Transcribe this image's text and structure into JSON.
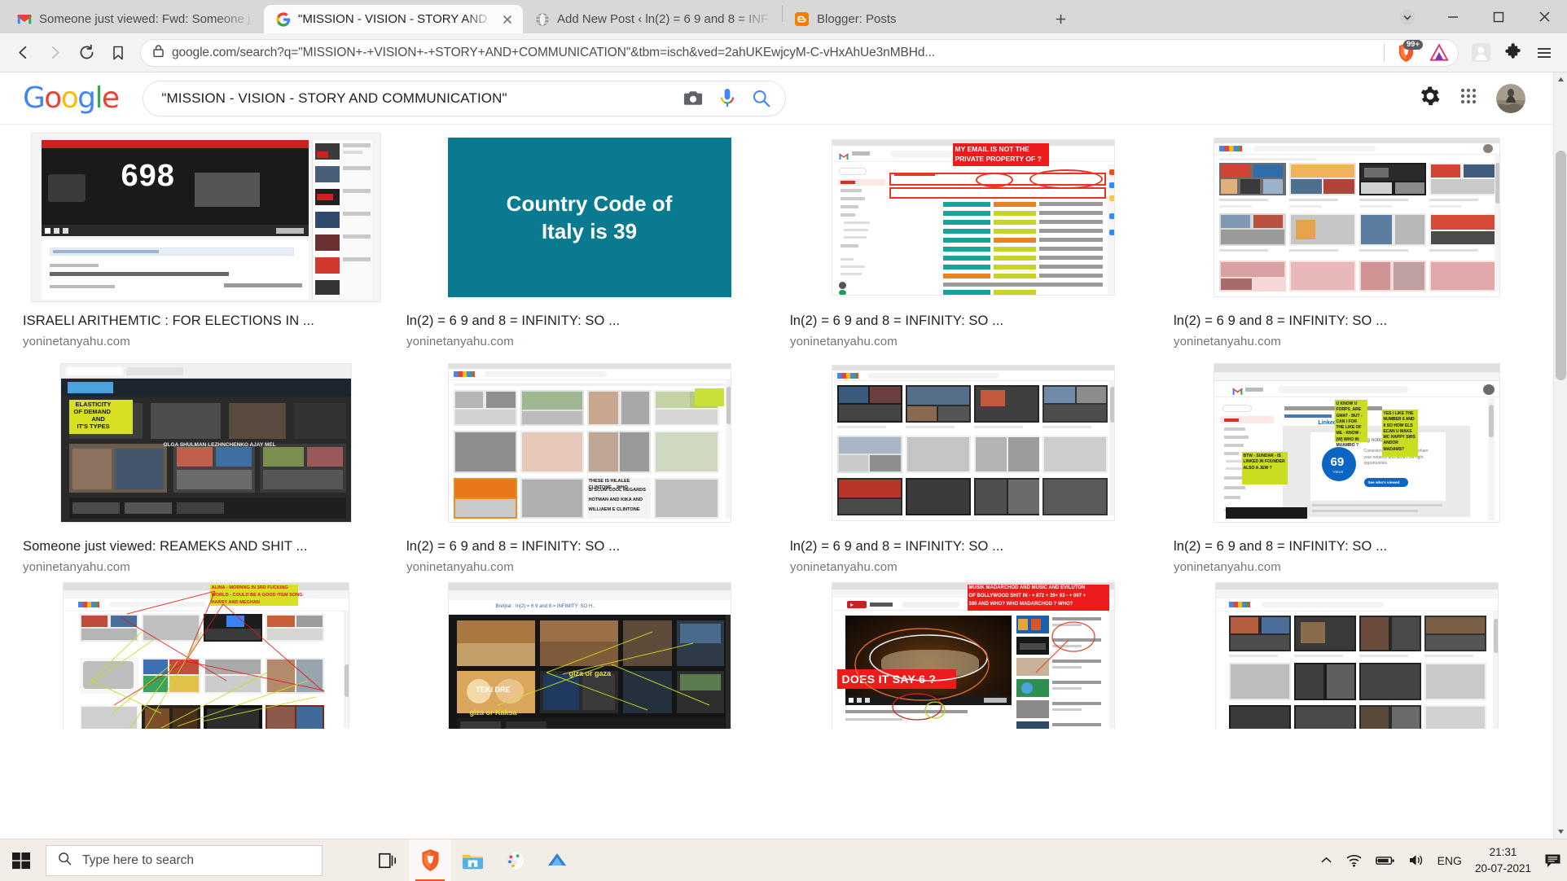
{
  "window": {
    "tabs": [
      {
        "title": "Someone just viewed: Fwd: Someone j",
        "favicon": "gmail-icon",
        "active": false
      },
      {
        "title": "\"MISSION - VISION - STORY AND",
        "favicon": "google-icon",
        "active": true
      },
      {
        "title": "Add New Post ‹ ln(2) = 6 9 and 8 = INF",
        "favicon": "globe-icon",
        "active": false
      },
      {
        "title": "Blogger: Posts",
        "favicon": "blogger-icon",
        "active": false
      }
    ],
    "new_tab_label": "+",
    "controls": {
      "minimize": "–",
      "maximize": "☐",
      "close": "✕",
      "tab_list": "▾"
    }
  },
  "toolbar": {
    "back": "back-arrow",
    "forward": "forward-arrow",
    "reload": "reload-arrow",
    "bookmark": "bookmark-outline",
    "url": "google.com/search?q=\"MISSION+-+VISION+-+STORY+AND+COMMUNICATION\"&tbm=isch&ved=2ahUKEwjcyM-C-vHxAhUe3nMBHd...",
    "shields_badge": "99+",
    "icons": [
      "brave-shields-icon",
      "brave-rewards-icon",
      "profile-icon",
      "extensions-icon",
      "menu-icon"
    ]
  },
  "google": {
    "logo": "Google",
    "query": "\"MISSION - VISION - STORY AND COMMUNICATION\"",
    "search_icons": [
      "camera-icon",
      "microphone-icon",
      "search-icon"
    ],
    "header_icons": [
      "settings-gear-icon",
      "google-apps-icon",
      "account-avatar"
    ]
  },
  "results": [
    [
      {
        "title": "ISRAELI ARITHEMTIC : FOR ELECTIONS IN ...",
        "site": "yoninetanyahu.com",
        "kind": "youtube-dark",
        "big_number": "698"
      },
      {
        "title": "ln(2) = 6 9 and 8 = INFINITY: SO ...",
        "site": "yoninetanyahu.com",
        "kind": "teal-slide",
        "slide_line1": "Country Code of",
        "slide_line2": "Italy is 39",
        "bg": "#0a7a91"
      },
      {
        "title": "ln(2) = 6 9 and 8 = INFINITY: SO ...",
        "site": "yoninetanyahu.com",
        "kind": "gmail-redbox",
        "overlay_line1": "MY EMAIL IS NOT THE",
        "overlay_line2": "PRIVATE PROPERTY OF ?"
      },
      {
        "title": "ln(2) = 6 9 and 8 = INFINITY: SO ...",
        "site": "yoninetanyahu.com",
        "kind": "google-grid"
      }
    ],
    [
      {
        "title": "Someone just viewed: REAMEKS AND SHIT ...",
        "site": "yoninetanyahu.com",
        "kind": "dark-collage",
        "overlay_line1": "ELASTICITY",
        "overlay_line2": "OF DEMAND",
        "overlay_line3": "AND",
        "overlay_line4": "IT'S TYPES",
        "caption_note": "OLGA SHULMAN LEZHNCHENKO AJAY MEL"
      },
      {
        "title": "ln(2) = 6 9 and 8 = INFINITY: SO ...",
        "site": "yoninetanyahu.com",
        "kind": "images-grid-yellow",
        "note_line1": "THESE IS HILALEE CLINTONE .. WHO",
        "note_line2": "SI SCUM COOL REGARDS",
        "note_line3": "HOTMAN AND KIKA AND",
        "note_line4": "WILLIAEM E CLINTONE"
      },
      {
        "title": "ln(2) = 6 9 and 8 = INFINITY: SO ...",
        "site": "yoninetanyahu.com",
        "kind": "dark-search-grid"
      },
      {
        "title": "ln(2) = 6 9 and 8 = INFINITY: SO ...",
        "site": "yoninetanyahu.com",
        "kind": "linkedin-notes",
        "note1": "BTW - SUNDAR - IS LINKED IN FOUNDER ALSO A JEW ?",
        "note2": "U KNOW U FORPS_ARE GMAT - BUT - CAN I FOR THE LIKE OF ME - KNOW - (W) WHO IN MUAMRO ?",
        "note3": "YES I LIKE THE NUMBER 6 AND 9   SO HOW ELS ECAN U MAKE MC HAPPY SIRS ANDOR MADAMS?",
        "card_title": "You're getting noticed",
        "card_number": "69",
        "card_sub": "Views",
        "card_text": "Consistent profile visionary to share your network and attract the right opportunities.",
        "card_button": "See who's viewed"
      }
    ],
    [
      {
        "title": "",
        "site": "",
        "kind": "map-lines",
        "overlay_line1": "ALINA - MORNNG IN 3RD FUCKING",
        "overlay_line2": "WORLD - COULD BE A GOOD ITEM SONG",
        "overlay_line3": "HARRY AND MEGHAN"
      },
      {
        "title": "",
        "site": "",
        "kind": "food-dark",
        "label1": "giza or gaza",
        "label2": "TEKI DRE",
        "label3": "giza or Kaksa",
        "topbar": "Bretjrar : ln(2) = 6 9 and 8 = INFIMITY: SO H.."
      },
      {
        "title": "",
        "site": "",
        "kind": "youtube-red",
        "overlay_line1": "MUSIK MADARCHOD  AND MUSIC AND EVILUTON",
        "overlay_line2": "OF BOLLYWOOD SHIT IN - + 872 + 39+ 93 - + 007 +",
        "overlay_line3": "380 AND WHO? WHO MADARCHOD ? WHO?",
        "banner": "DOES IT SAY 6 ?"
      },
      {
        "title": "",
        "site": "",
        "kind": "google-dark-grid"
      }
    ]
  ],
  "taskbar": {
    "start": "windows-start-icon",
    "search_placeholder": "Type here to search",
    "apps": [
      "task-view-icon",
      "brave-browser-icon",
      "file-explorer-icon",
      "paint-icon",
      "blue-app-icon"
    ],
    "tray": {
      "chevron": "show-hidden-icons",
      "wifi": "wifi-icon",
      "battery": "battery-charging-icon",
      "volume": "volume-icon",
      "language": "ENG",
      "time": "21:31",
      "date": "20-07-2021",
      "notifications": "action-center-icon"
    }
  },
  "colors": {
    "brave_orange": "#eb5b1e",
    "teal_slide": "#0a7a91",
    "red_overlay": "#ec1c1c",
    "yellow_note": "#d6e32a",
    "google_blue": "#4285f4"
  }
}
